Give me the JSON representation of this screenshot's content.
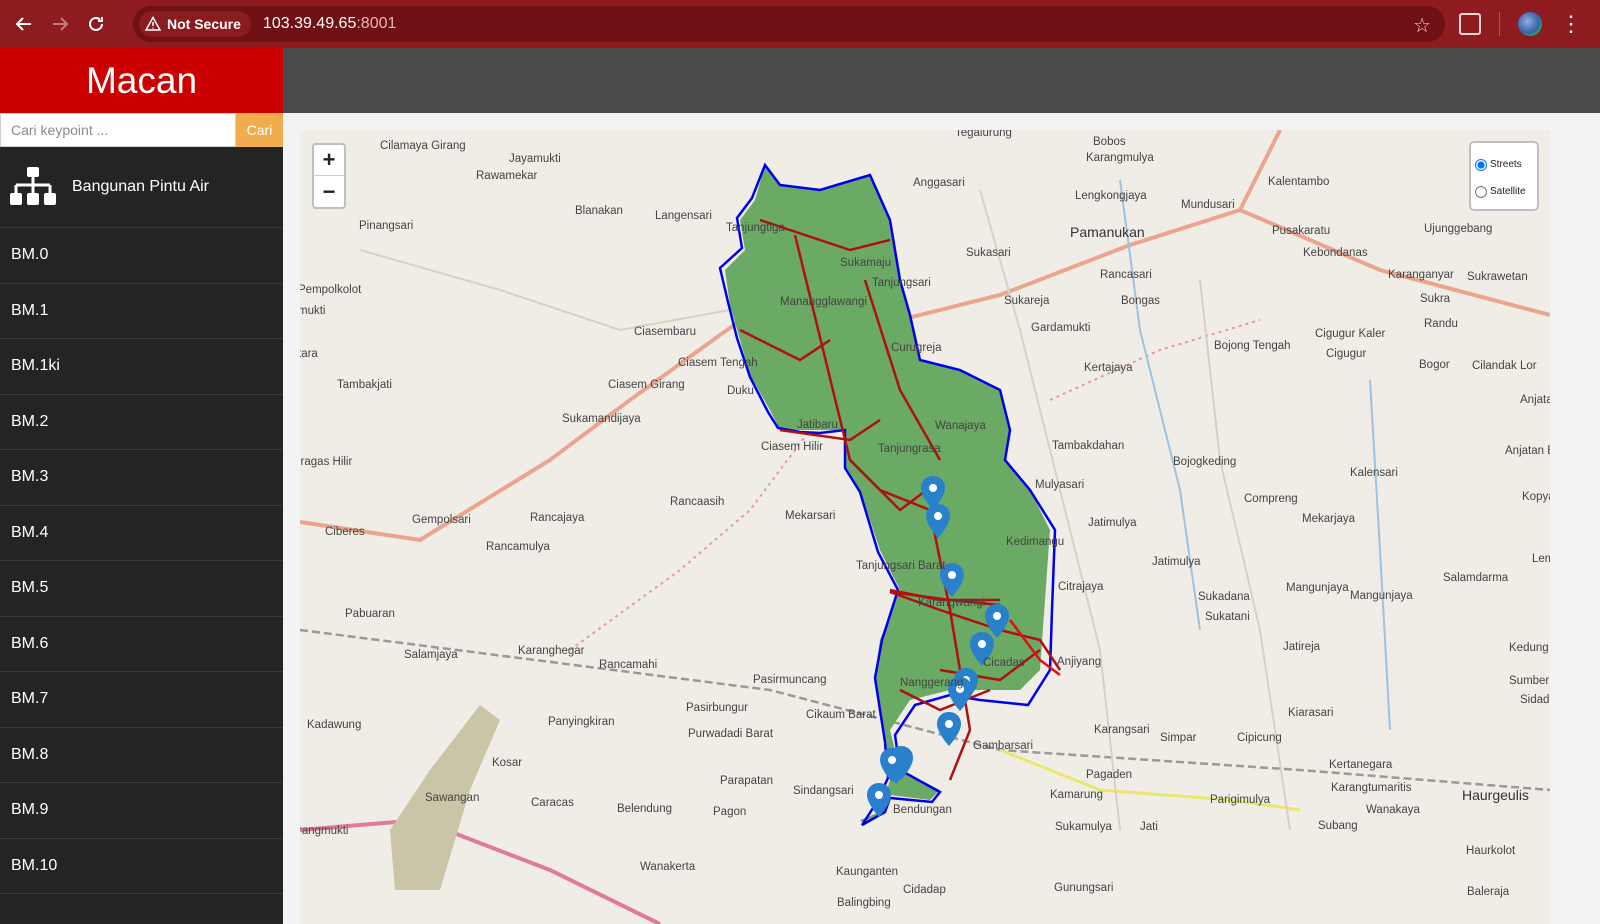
{
  "browser": {
    "security_label": "Not Secure",
    "url_host": "103.39.49.65",
    "url_port": ":8001",
    "icons": [
      "back-icon",
      "forward-icon",
      "reload-icon",
      "warning-icon",
      "star-icon",
      "extensions-icon",
      "profile-avatar",
      "menu-icon"
    ]
  },
  "app": {
    "title": "Macan",
    "search_placeholder": "Cari keypoint ...",
    "search_button": "Cari",
    "group_title": "Bangunan Pintu Air",
    "group_icon": "sitemap-icon",
    "items": [
      "BM.0",
      "BM.1",
      "BM.1ki",
      "BM.2",
      "BM.3",
      "BM.4",
      "BM.5",
      "BM.6",
      "BM.7",
      "BM.8",
      "BM.9",
      "BM.10"
    ]
  },
  "map": {
    "zoom_in": "+",
    "zoom_out": "−",
    "layer_streets": "Streets",
    "layer_satellite": "Satellite",
    "selected_layer": "Streets",
    "marker_count": 12,
    "colors": {
      "area_fill": "#6aaa64",
      "boundary": "#0000ee",
      "canal": "#b01010",
      "marker": "#2a81cb"
    },
    "place_labels": [
      "Tegalurung",
      "Cilamaya Girang",
      "Jayamukti",
      "Bobos",
      "Karangmulya",
      "Rawamekar",
      "Anggasari",
      "Kalentambo",
      "Blanakan",
      "Langensari",
      "Lengkongjaya",
      "Mundusari",
      "Ujunggebang",
      "Pinangsari",
      "Tanjungtiga",
      "Pamanukan",
      "Pusakaratu",
      "Sukamaju",
      "Sukasari",
      "Kebondanas",
      "Karanganyar",
      "Sukrawetan",
      "Pempolkolot",
      "Tanjungsari",
      "Rancasari",
      "Sukra",
      "mukti",
      "Bongas",
      "Sukareja",
      "Randu",
      "Manangglawangi",
      "Ciasembaru",
      "Gardamukti",
      "Cigugur Kaler",
      "Curugreja",
      "Bojong Tengah",
      "Cigugur",
      "tara",
      "Ciasem Tengah",
      "Kertajaya",
      "Bogor",
      "Cilandak Lor",
      "Tambakjati",
      "Ciasem Girang",
      "Duku",
      "Anjatan",
      "Sukamandijaya",
      "Jatibaru",
      "Wanajaya",
      "Anjatan Baru",
      "Ciasem Hilir",
      "Tanjungrasa",
      "Tambakdahan",
      "iragas Hilir",
      "Bojogkeding",
      "Kalensari",
      "Mulyasari",
      "Rancaasih",
      "Compreng",
      "Kopya",
      "Mekarsari",
      "Jatimulya",
      "Mekarjaya",
      "Ciberes",
      "Gempolsari",
      "Rancajaya",
      "Kedimangu",
      "Rancamulya",
      "Tanjungsari Barat",
      "Jatimulya",
      "Lemj",
      "Citrajaya",
      "Salamdarma",
      "Sukadana",
      "Mangunjaya",
      "Pabuaran",
      "Karangwangi",
      "Sukatani",
      "Mangunjaya",
      "Salamjaya",
      "Karanghegar",
      "Rancamahi",
      "Cicadas",
      "Anjiyang",
      "Jatireja",
      "Kedung",
      "Nanggerang",
      "Pasirmuncang",
      "Sumberhul",
      "Kiarasari",
      "Sidadi",
      "Kadawung",
      "Panyingkiran",
      "Pasirbungur",
      "Cikaum Barat",
      "Purwadadi Barat",
      "Karangsari",
      "Simpar",
      "Cipicung",
      "Gambarsari",
      "Kertanegara",
      "Kosar",
      "Parapatan",
      "Pagaden",
      "Karangtumaritis",
      "Haurgeulis",
      "Sawangan",
      "Caracas",
      "Sindangsari",
      "Belendung",
      "Pagon",
      "Kamarung",
      "Parigimulya",
      "Wanakaya",
      "Bendungan",
      "rangmukti",
      "Sukamulya",
      "Jati",
      "Subang",
      "Haurkolot",
      "Wanakerta",
      "Kaunganten",
      "Cidadap",
      "Gunungsari",
      "Baleraja",
      "Balingbing"
    ]
  }
}
